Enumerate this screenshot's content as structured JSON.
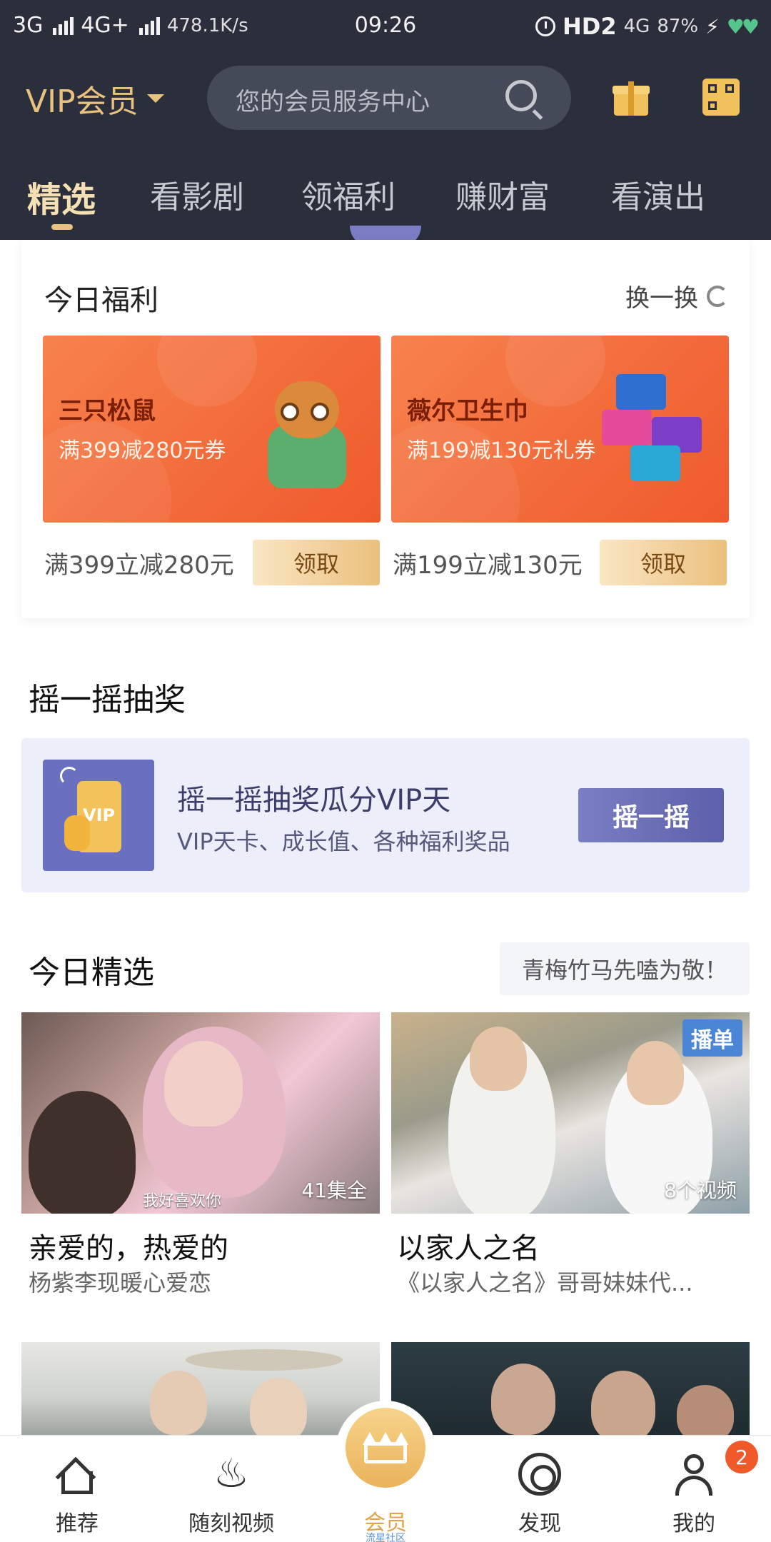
{
  "status_bar": {
    "net1": "3G",
    "net2": "4G+",
    "speed": "478.1K/s",
    "time": "09:26",
    "hd": "HD2",
    "net3": "4G",
    "battery": "87%"
  },
  "header": {
    "title": "VIP会员",
    "search_placeholder": "您的会员服务中心",
    "icons": [
      "gift-icon",
      "qr-card-icon"
    ],
    "accent_color": "#e8c27e",
    "background_color": "#2b2f3b"
  },
  "tabs": [
    {
      "label": "精选",
      "active": true
    },
    {
      "label": "看影剧",
      "active": false
    },
    {
      "label": "领福利",
      "active": false
    },
    {
      "label": "赚财富",
      "active": false
    },
    {
      "label": "看演出",
      "active": false
    }
  ],
  "welfare": {
    "title": "今日福利",
    "refresh_label": "换一换",
    "coupons": [
      {
        "brand": "三只松鼠",
        "desc": "满399减280元券",
        "line": "满399立减280元",
        "claim": "领取"
      },
      {
        "brand": "薇尔卫生巾",
        "desc": "满199减130元礼券",
        "line": "满199立减130元",
        "claim": "领取"
      }
    ]
  },
  "shake": {
    "section_title": "摇一摇抽奖",
    "icon_text": "VIP",
    "title": "摇一摇抽奖瓜分VIP天",
    "subtitle": "VIP天卡、成长值、各种福利奖品",
    "button": "摇一摇"
  },
  "picks": {
    "section_title": "今日精选",
    "tag": "青梅竹马先嗑为敬！",
    "videos": [
      {
        "title": "亲爱的，热爱的",
        "subtitle": "杨紫李现暖心爱恋",
        "badge": "",
        "count": "41集全",
        "caption": "我好喜欢你"
      },
      {
        "title": "以家人之名",
        "subtitle": "《以家人之名》哥哥妹妹代...",
        "badge": "播单",
        "count": "8个视频",
        "caption": ""
      }
    ]
  },
  "bottom_nav": {
    "items": [
      {
        "label": "推荐",
        "icon": "home-icon"
      },
      {
        "label": "随刻视频",
        "icon": "flame-icon"
      },
      {
        "label": "会员",
        "icon": "crown-icon",
        "sub": "流星社区"
      },
      {
        "label": "发现",
        "icon": "discover-icon"
      },
      {
        "label": "我的",
        "icon": "user-icon"
      }
    ],
    "badge_count": "2"
  }
}
